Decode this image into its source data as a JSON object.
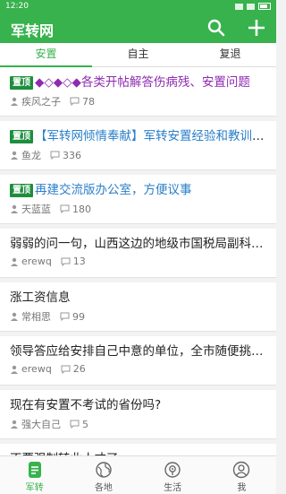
{
  "status": {
    "time": "12:20"
  },
  "app": {
    "title": "军转网"
  },
  "tabs": [
    {
      "label": "安置",
      "active": true
    },
    {
      "label": "自主",
      "active": false
    },
    {
      "label": "复退",
      "active": false
    }
  ],
  "pin_label": "置顶",
  "posts": [
    {
      "pinned": true,
      "title": "◆◇◆◇◆各类开帖解答伤病残、安置问题",
      "style": "purple",
      "author": "疾风之子",
      "comments": "78"
    },
    {
      "pinned": true,
      "title": "【军转网倾情奉献】军转安置经验和教训汇编",
      "style": "blue",
      "author": "鱼龙",
      "comments": "336"
    },
    {
      "pinned": true,
      "title": "再建交流版办公室，方便议事",
      "style": "blue",
      "author": "天蓝蓝",
      "comments": "180"
    },
    {
      "pinned": false,
      "title": "弱弱的问一句，山西这边的地级市国税局副科级安置",
      "style": "normal",
      "author": "erewq",
      "comments": "13"
    },
    {
      "pinned": false,
      "title": "涨工资信息",
      "style": "normal",
      "author": "常相思",
      "comments": "99"
    },
    {
      "pinned": false,
      "title": "领导答应给安排自己中意的单位，全市随便挑选吗",
      "style": "normal",
      "author": "erewq",
      "comments": "26"
    },
    {
      "pinned": false,
      "title": "现在有安置不考试的省份吗?",
      "style": "normal",
      "author": "强大自己",
      "comments": "5"
    },
    {
      "pinned": false,
      "title": "不要强制转业人才了",
      "style": "normal",
      "author": "",
      "comments": ""
    }
  ],
  "bottom_nav": [
    {
      "label": "军转",
      "icon": "document-icon",
      "active": true
    },
    {
      "label": "各地",
      "icon": "globe-icon",
      "active": false
    },
    {
      "label": "生活",
      "icon": "radio-icon",
      "active": false
    },
    {
      "label": "我",
      "icon": "person-icon",
      "active": false
    }
  ],
  "colors": {
    "primary": "#37b24d",
    "pin": "#1e8e3e",
    "purple": "#8e2bb0",
    "blue": "#2a7fc9"
  }
}
